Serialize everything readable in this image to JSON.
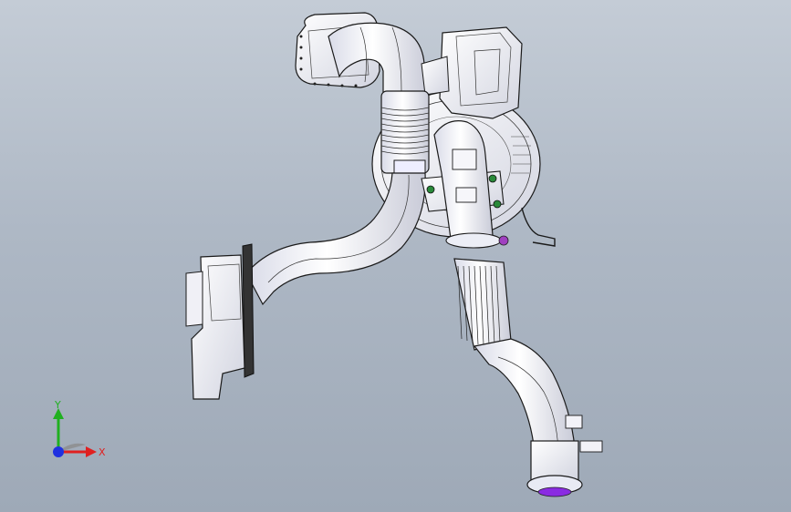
{
  "viewport": {
    "background_top": "#c4ccd6",
    "background_bottom": "#9ea9b7"
  },
  "model": {
    "line_color": "#1a1a1a",
    "fill_color": "#f4f4f8",
    "accent_color": "#8a2be2"
  },
  "triad": {
    "x_label": "X",
    "y_label": "Y",
    "x_color": "#e02020",
    "y_color": "#20b020",
    "z_color": "#2030e0"
  }
}
